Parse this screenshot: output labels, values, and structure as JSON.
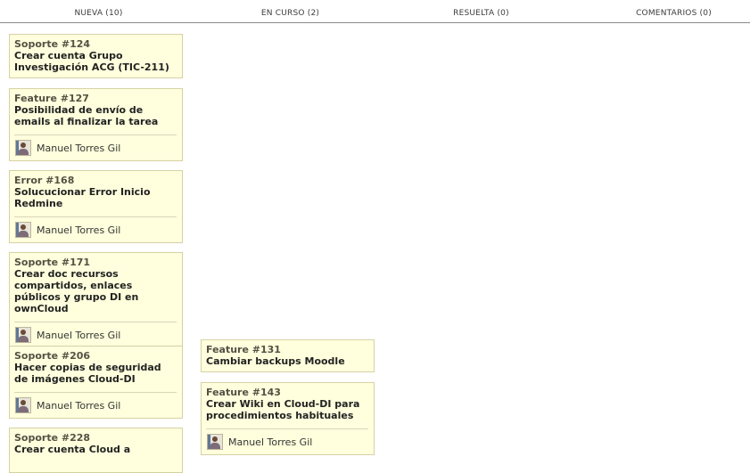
{
  "columns": [
    {
      "label": "NUEVA (10)"
    },
    {
      "label": "EN CURSO (2)"
    },
    {
      "label": "RESUELTA (0)"
    },
    {
      "label": "COMENTARIOS (0)"
    }
  ],
  "cards_nueva": [
    {
      "id": "Soporte #124",
      "title": "Crear cuenta Grupo Investigación ACG (TIC-211)"
    },
    {
      "id": "Feature #127",
      "title": "Posibilidad de envío de emails al finalizar la tarea",
      "assignee": "Manuel Torres Gil"
    },
    {
      "id": "Error #168",
      "title": "Solucucionar Error Inicio Redmine",
      "assignee": "Manuel Torres Gil"
    },
    {
      "id": "Soporte #171",
      "title": "Crear doc recursos compartidos, enlaces públicos y grupo DI en ownCloud",
      "assignee": "Manuel Torres Gil"
    },
    {
      "id": "Soporte #206",
      "title": "Hacer copias de seguridad de imágenes Cloud-DI",
      "assignee": "Manuel Torres Gil"
    },
    {
      "id": "Soporte #228",
      "title": "Crear cuenta Cloud a"
    }
  ],
  "cards_encurso": [
    {
      "id": "Feature #131",
      "title": "Cambiar backups Moodle"
    },
    {
      "id": "Feature #143",
      "title": "Crear Wiki en Cloud-DI para procedimientos habituales",
      "assignee": "Manuel Torres Gil"
    }
  ]
}
